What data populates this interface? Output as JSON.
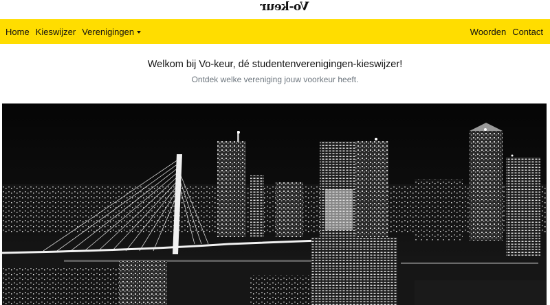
{
  "brand": {
    "logo_text": "Vo-keur"
  },
  "nav": {
    "left_items": [
      "Home",
      "Kieswijzer",
      "Verenigingen"
    ],
    "right_items": [
      "Woorden",
      "Contact"
    ]
  },
  "hero": {
    "title": "Welkom bij Vo-keur, dé studentenverenigingen-kieswijzer!",
    "subtitle": "Ontdek welke vereniging jouw voorkeur heeft."
  },
  "photo": {
    "subject": "black-and-white night skyline of Rotterdam with Erasmus bridge"
  },
  "colors": {
    "navbar": "#ffdd00",
    "subtitle": "#6c757d",
    "text": "#111111"
  }
}
